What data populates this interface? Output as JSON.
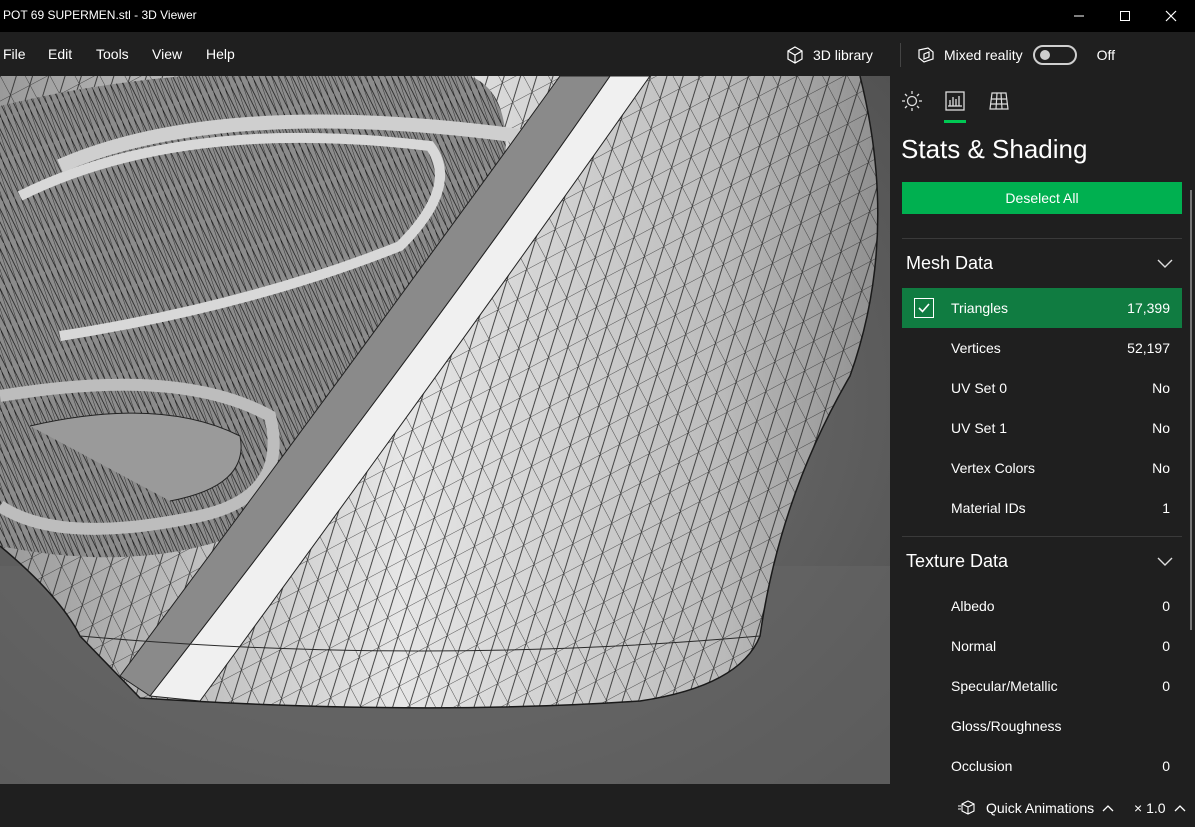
{
  "window": {
    "title": "POT 69 SUPERMEN.stl - 3D Viewer"
  },
  "menu": {
    "items": [
      "File",
      "Edit",
      "Tools",
      "View",
      "Help"
    ],
    "library_label": "3D library",
    "mixed_reality_label": "Mixed reality",
    "mixed_reality_state": "Off"
  },
  "panel": {
    "title": "Stats & Shading",
    "deselect_label": "Deselect All",
    "accent": "#00b050",
    "mesh": {
      "title": "Mesh Data",
      "rows": [
        {
          "label": "Triangles",
          "value": "17,399",
          "selected": true
        },
        {
          "label": "Vertices",
          "value": "52,197"
        },
        {
          "label": "UV Set 0",
          "value": "No"
        },
        {
          "label": "UV Set 1",
          "value": "No"
        },
        {
          "label": "Vertex Colors",
          "value": "No"
        },
        {
          "label": "Material IDs",
          "value": "1"
        }
      ]
    },
    "texture": {
      "title": "Texture Data",
      "rows": [
        {
          "label": "Albedo",
          "value": "0"
        },
        {
          "label": "Normal",
          "value": "0"
        },
        {
          "label": "Specular/Metallic",
          "value": "0"
        },
        {
          "label": "Gloss/Roughness",
          "value": ""
        },
        {
          "label": "Occlusion",
          "value": "0"
        }
      ]
    }
  },
  "status": {
    "animations_label": "Quick Animations",
    "speed": "× 1.0"
  }
}
